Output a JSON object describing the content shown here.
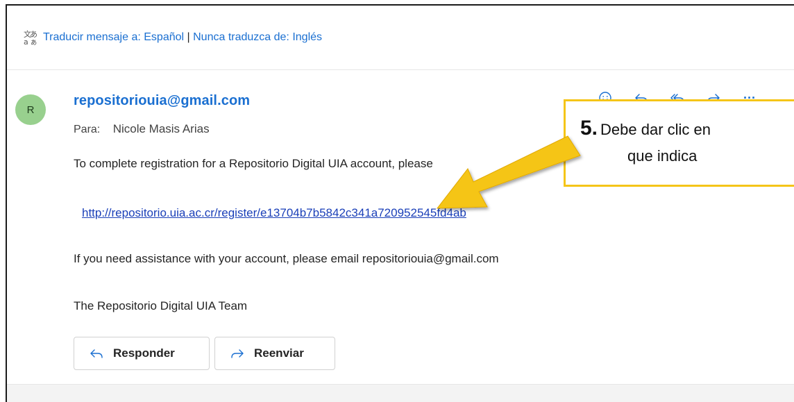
{
  "translate": {
    "prefix": "Traducir mensaje a: Español",
    "separator": "|",
    "never": "Nunca traduzca de: Inglés",
    "icon": "translate-icon"
  },
  "message": {
    "avatar_initial": "R",
    "avatar_color": "#98d08e",
    "sender": "repositoriouia@gmail.com",
    "to_label": "Para:",
    "to_name": "Nicole Masis Arias",
    "body_line1": "To complete registration for a Repositorio Digital UIA account, please",
    "link": "http://repositorio.uia.ac.cr/register/e13704b7b5842c341a720952545fd4ab",
    "body_line3": "If you need assistance with your account, please email repositoriouia@gmail.com",
    "body_line4": "The Repositorio Digital UIA Team"
  },
  "actions": {
    "icons": [
      "emoji-icon",
      "reply-icon",
      "reply-all-icon",
      "forward-icon",
      "more-icon"
    ],
    "more_label": "···"
  },
  "buttons": {
    "reply": "Responder",
    "forward": "Reenviar"
  },
  "callout": {
    "number": "5.",
    "line1": "Debe dar clic en",
    "line2": "que indica",
    "border_color": "#f5c518",
    "arrow_color": "#f5c518"
  },
  "colors": {
    "link": "#1a6fd1",
    "body_link": "#1a3fb8"
  }
}
